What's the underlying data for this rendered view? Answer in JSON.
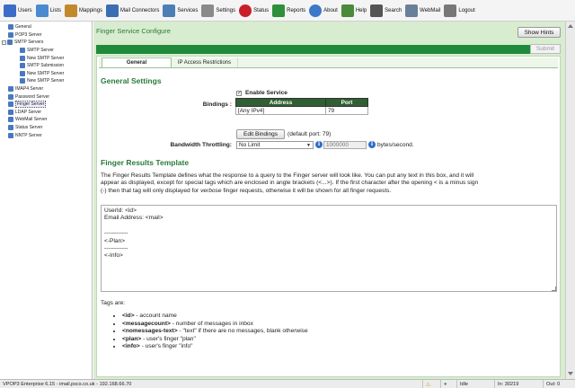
{
  "toolbar": {
    "items": [
      {
        "label": "Users",
        "icon": "users-icon",
        "color": "#3a6cc8"
      },
      {
        "label": "Lists",
        "icon": "lists-icon",
        "color": "#4a8ad0"
      },
      {
        "label": "Mappings",
        "icon": "mappings-icon",
        "color": "#c0892c"
      },
      {
        "label": "Mail Connectors",
        "icon": "mail-connectors-icon",
        "color": "#3b6db3"
      },
      {
        "label": "Services",
        "icon": "services-icon",
        "color": "#4d7fb5"
      },
      {
        "label": "Settings",
        "icon": "settings-icon",
        "color": "#8a8a8a"
      },
      {
        "label": "Status",
        "icon": "status-heart-icon",
        "color": "#c8202a"
      },
      {
        "label": "Reports",
        "icon": "reports-icon",
        "color": "#2f8f3a"
      },
      {
        "label": "About",
        "icon": "about-info-icon",
        "color": "#3d78c8"
      },
      {
        "label": "Help",
        "icon": "help-icon",
        "color": "#4a8a3a"
      },
      {
        "label": "Search",
        "icon": "search-icon",
        "color": "#555555"
      },
      {
        "label": "WebMail",
        "icon": "webmail-icon",
        "color": "#6a7f9a"
      },
      {
        "label": "Logout",
        "icon": "logout-icon",
        "color": "#777777"
      }
    ]
  },
  "tree": {
    "items": [
      {
        "label": "General",
        "indent": 0,
        "color": "#4a78c0"
      },
      {
        "label": "POP3 Server",
        "indent": 0,
        "color": "#4a78c0"
      },
      {
        "label": "SMTP Servers",
        "indent": 0,
        "color": "#4a78c0",
        "expander": "−"
      },
      {
        "label": "SMTP Server",
        "indent": 1,
        "color": "#4a78c0"
      },
      {
        "label": "New SMTP Server",
        "indent": 1,
        "color": "#4a78c0"
      },
      {
        "label": "SMTP Submission",
        "indent": 1,
        "color": "#4a78c0"
      },
      {
        "label": "New SMTP Server",
        "indent": 1,
        "color": "#4a78c0"
      },
      {
        "label": "New SMTP Server",
        "indent": 1,
        "color": "#4a78c0"
      },
      {
        "label": "IMAP4 Server",
        "indent": 0,
        "color": "#4a78c0"
      },
      {
        "label": "Password Server",
        "indent": 0,
        "color": "#4a78c0"
      },
      {
        "label": "Finger Server",
        "indent": 0,
        "color": "#4a78c0",
        "selected": true
      },
      {
        "label": "LDAP Server",
        "indent": 0,
        "color": "#4a78c0"
      },
      {
        "label": "WebMail Server",
        "indent": 0,
        "color": "#4a78c0"
      },
      {
        "label": "Status Server",
        "indent": 0,
        "color": "#4a78c0"
      },
      {
        "label": "NNTP Server",
        "indent": 0,
        "color": "#4a78c0"
      }
    ]
  },
  "main": {
    "title": "Finger Service Configure",
    "show_hints_label": "Show Hints",
    "submit_label": "Submit",
    "tabs": [
      {
        "label": "General",
        "active": true
      },
      {
        "label": "IP Access Restrictions",
        "active": false
      }
    ],
    "general_settings_heading": "General Settings",
    "enable_service_label": "Enable Service",
    "enable_service_checked": true,
    "bindings_label": "Bindings :",
    "bindings_table": {
      "headers": [
        "Address",
        "Port"
      ],
      "rows": [
        [
          "[Any IPv4]",
          "79"
        ]
      ]
    },
    "edit_bindings_label": "Edit Bindings",
    "default_port_text": "(default port: 79)",
    "bandwidth_label": "Bandwidth Throttling:",
    "bandwidth_value": "No Limit",
    "bandwidth_number": "1000000",
    "bandwidth_unit": "bytes/second.",
    "results_heading": "Finger Results Template",
    "description_line1": "The Finger Results Template defines what the response to a query to the Finger server will look like. You can put any text in this box, and it will",
    "description_line2": "appear as displayed, except for special tags which are enclosed in angle brackets (<...>). If the first character after the opening < is a minus sign",
    "description_line3a": "(-) then that tag will only displayed for ",
    "description_line3_em": "verbose",
    "description_line3b": " finger requests, otherwise it will be shown for all finger requests.",
    "template_text": "UserId: <id>\nEmail Address: <mail>\n\n------------\n<-Plan>\n------------\n<-Info>",
    "tags_intro": "Tags are:",
    "tags": [
      {
        "tag": "<id>",
        "desc": " - account name"
      },
      {
        "tag": "<messagecount>",
        "desc": " - number of messages in inbox"
      },
      {
        "tag": "<nomessages-text>",
        "desc": " - \"text\" if there are no messages, blank otherwise"
      },
      {
        "tag": "<plan>",
        "desc": " - user's finger \"plan\""
      },
      {
        "tag": "<info>",
        "desc": " - user's finger \"info\""
      }
    ]
  },
  "statusbar": {
    "app_text": "VPOP3 Enterprise 6.15 - imail.pscs.co.uk - 192.168.66.70",
    "status": "Idle",
    "in": "In: 30219",
    "out": "Out: 0"
  },
  "colors": {
    "accent_green": "#2a7a3a",
    "bar_green": "#1f8a3c",
    "panel_bg": "#d8ecd0",
    "table_header": "#2f5f32",
    "info_blue": "#2d6fc6"
  }
}
